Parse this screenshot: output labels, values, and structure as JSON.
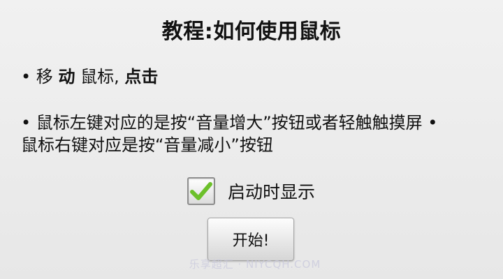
{
  "dialog": {
    "title": "教程:如何使用鼠标",
    "line1": {
      "bullet": "• ",
      "part_a": "移",
      "part_b": "动",
      "part_c": "鼠标,",
      "part_d": "点击"
    },
    "line2": "• 鼠标左键对应的是按“音量增大”按钮或者轻触触摸屏 •",
    "line3": "鼠标右键对应是按“音量减小”按钮",
    "show_on_start": {
      "label": "启动时显示",
      "checked": true
    },
    "start_button_label": "开始!"
  },
  "watermark": "乐享超汇 · NIYCQH.COM",
  "colors": {
    "background": "#ececec",
    "checkmark": "#6cc02a"
  }
}
